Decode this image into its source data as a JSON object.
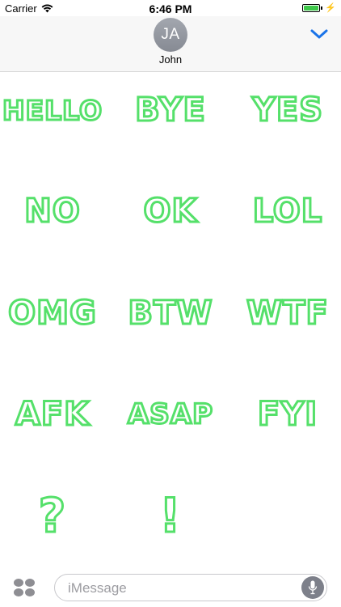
{
  "status_bar": {
    "carrier": "Carrier",
    "time": "6:46 PM",
    "battery_level": 1.0
  },
  "header": {
    "avatar_initials": "JA",
    "contact_name": "John"
  },
  "stickers": [
    "HELLO",
    "BYE",
    "YES",
    "NO",
    "OK",
    "LOL",
    "OMG",
    "BTW",
    "WTF",
    "AFK",
    "ASAP",
    "FYI",
    "?",
    "!"
  ],
  "input": {
    "placeholder": "iMessage",
    "value": ""
  },
  "colors": {
    "sticker_green": "#55e06a",
    "accent_blue": "#1a73e8"
  }
}
